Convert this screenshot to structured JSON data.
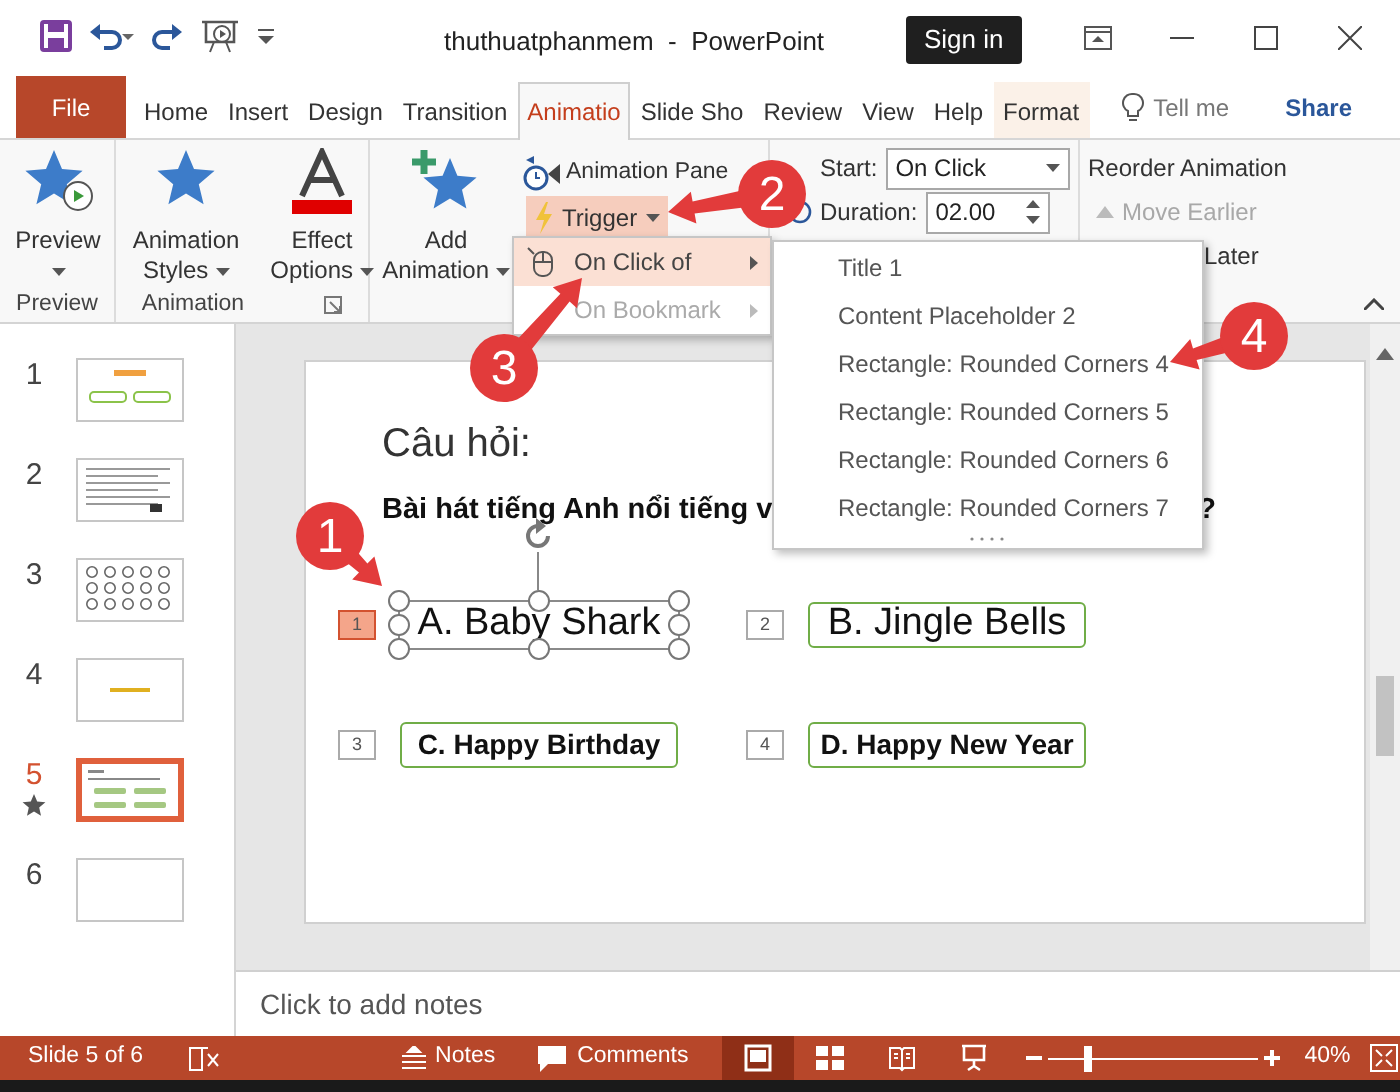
{
  "window": {
    "title": "thuthuatphanmem  -  PowerPoint",
    "sign_in": "Sign in"
  },
  "tabs": [
    {
      "label": "File",
      "kind": "file",
      "selected": false
    },
    {
      "label": "Home",
      "kind": "tab",
      "selected": false
    },
    {
      "label": "Insert",
      "kind": "tab",
      "selected": false
    },
    {
      "label": "Design",
      "kind": "tab",
      "selected": false
    },
    {
      "label": "Transition",
      "kind": "tab",
      "selected": false
    },
    {
      "label": "Animatio",
      "kind": "tab",
      "selected": true
    },
    {
      "label": "Slide Sho",
      "kind": "tab",
      "selected": false
    },
    {
      "label": "Review",
      "kind": "tab",
      "selected": false
    },
    {
      "label": "View",
      "kind": "tab",
      "selected": false
    },
    {
      "label": "Help",
      "kind": "tab",
      "selected": false
    },
    {
      "label": "Format",
      "kind": "context",
      "selected": false
    }
  ],
  "tell_me": "Tell me",
  "share": "Share",
  "ribbon": {
    "preview": {
      "button": "Preview",
      "group": "Preview"
    },
    "animation": {
      "styles": "Animation Styles",
      "effect": "Effect Options",
      "group": "Animation"
    },
    "advanced": {
      "add": "Add Animation",
      "pane": "Animation Pane",
      "trigger": "Trigger"
    },
    "timing": {
      "start_label": "Start:",
      "start_value": "On Click",
      "duration_label": "Duration:",
      "duration_value": "02.00"
    },
    "reorder": {
      "title": "Reorder Animation",
      "move_earlier": "Move Earlier",
      "move_earlier_disabled": true,
      "move_later": "Later"
    }
  },
  "trigger_menu": [
    {
      "label": "On Click of",
      "selected": true,
      "disabled": false
    },
    {
      "label": "On Bookmark",
      "selected": false,
      "disabled": true
    }
  ],
  "trigger_submenu": [
    "Title 1",
    "Content Placeholder 2",
    "Rectangle: Rounded Corners 4",
    "Rectangle: Rounded Corners 5",
    "Rectangle: Rounded Corners 6",
    "Rectangle: Rounded Corners 7"
  ],
  "thumbnails": [
    {
      "number": "1",
      "kind": "title",
      "selected": false,
      "animated": false
    },
    {
      "number": "2",
      "kind": "text",
      "selected": false,
      "animated": false
    },
    {
      "number": "3",
      "kind": "stars",
      "selected": false,
      "animated": false
    },
    {
      "number": "4",
      "kind": "caption",
      "selected": false,
      "animated": false
    },
    {
      "number": "5",
      "kind": "quiz",
      "selected": true,
      "animated": true
    },
    {
      "number": "6",
      "kind": "blank",
      "selected": false,
      "animated": false
    }
  ],
  "slide": {
    "title": "Câu hỏi:",
    "question": "Bài hát tiếng Anh nổi tiếng v",
    "question_end": "?",
    "answers": [
      {
        "tag": "1",
        "label": "A. Baby Shark",
        "selected": true,
        "bold": false
      },
      {
        "tag": "2",
        "label": "B. Jingle Bells",
        "selected": false,
        "bold": false
      },
      {
        "tag": "3",
        "label": "C. Happy Birthday",
        "selected": false,
        "bold": true
      },
      {
        "tag": "4",
        "label": "D. Happy New Year",
        "selected": false,
        "bold": true
      }
    ]
  },
  "notes": "Click to add notes",
  "status_bar": {
    "slide": "Slide 5 of 6",
    "notes": "Notes",
    "comments": "Comments",
    "views": [
      {
        "kind": "normal",
        "selected": true
      },
      {
        "kind": "sorter",
        "selected": false
      },
      {
        "kind": "reading",
        "selected": false
      },
      {
        "kind": "slideshow",
        "selected": false
      }
    ],
    "zoom": {
      "level": 0.17,
      "reading": "40%"
    }
  },
  "callouts": [
    "1",
    "2",
    "3",
    "4"
  ]
}
